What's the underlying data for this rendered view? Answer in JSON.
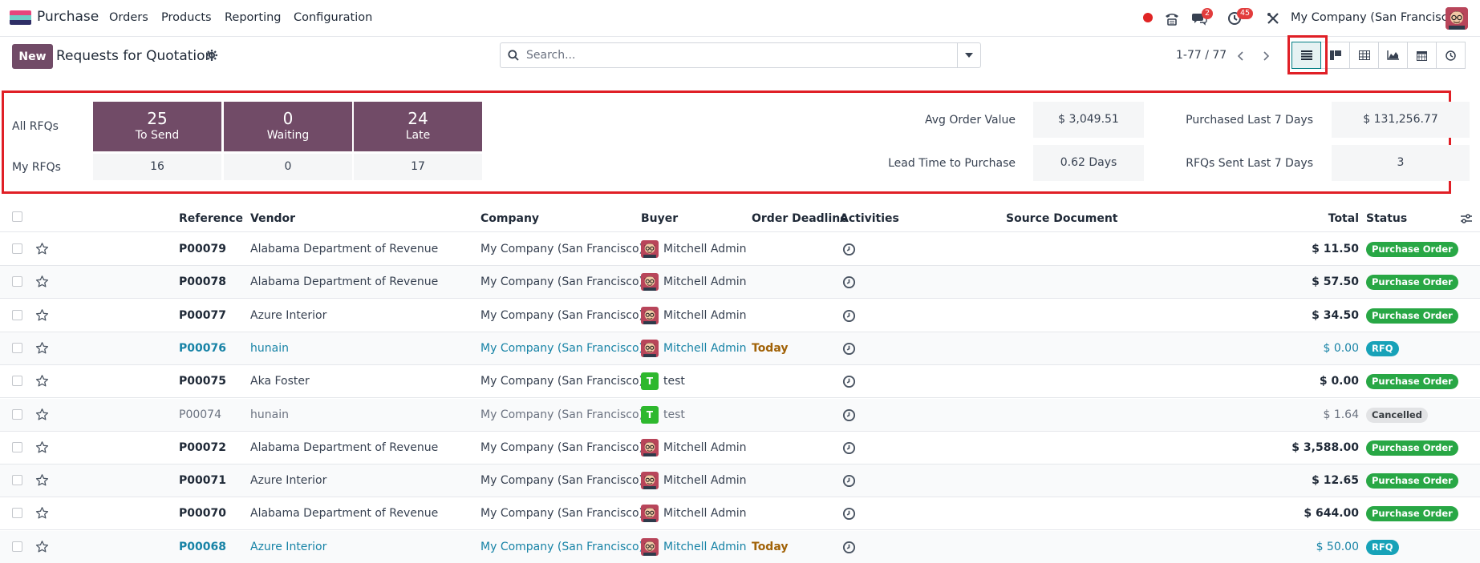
{
  "navbar": {
    "app_name": "Purchase",
    "menu": [
      "Orders",
      "Products",
      "Reporting",
      "Configuration"
    ],
    "messages_badge": "2",
    "activities_badge": "45",
    "company": "My Company (San Francisco)"
  },
  "control_panel": {
    "new_label": "New",
    "title": "Requests for Quotation",
    "search_placeholder": "Search...",
    "pager": "1-77 / 77",
    "views": [
      "list",
      "kanban",
      "pivot",
      "graph",
      "calendar",
      "activity"
    ],
    "active_view": "list"
  },
  "dashboard": {
    "all_rfqs_label": "All RFQs",
    "my_rfqs_label": "My RFQs",
    "tiles": [
      {
        "value": "25",
        "label": "To Send",
        "my": "16"
      },
      {
        "value": "0",
        "label": "Waiting",
        "my": "0"
      },
      {
        "value": "24",
        "label": "Late",
        "my": "17"
      }
    ],
    "kpis": [
      {
        "label": "Avg Order Value",
        "value": "$ 3,049.51"
      },
      {
        "label": "Purchased Last 7 Days",
        "value": "$ 131,256.77"
      },
      {
        "label": "Lead Time to Purchase",
        "value": "0.62 Days"
      },
      {
        "label": "RFQs Sent Last 7 Days",
        "value": "3"
      }
    ]
  },
  "table": {
    "headers": {
      "reference": "Reference",
      "vendor": "Vendor",
      "company": "Company",
      "buyer": "Buyer",
      "deadline": "Order Deadline",
      "activities": "Activities",
      "source": "Source Document",
      "total": "Total",
      "status": "Status"
    },
    "rows": [
      {
        "ref": "P00079",
        "vendor": "Alabama Department of Revenue",
        "company": "My Company (San Francisco)",
        "buyer": "Mitchell Admin",
        "buyer_avatar": "photo",
        "deadline": "",
        "total": "$ 11.50",
        "status": "Purchase Order",
        "kind": "po"
      },
      {
        "ref": "P00078",
        "vendor": "Alabama Department of Revenue",
        "company": "My Company (San Francisco)",
        "buyer": "Mitchell Admin",
        "buyer_avatar": "photo",
        "deadline": "",
        "total": "$ 57.50",
        "status": "Purchase Order",
        "kind": "po"
      },
      {
        "ref": "P00077",
        "vendor": "Azure Interior",
        "company": "My Company (San Francisco)",
        "buyer": "Mitchell Admin",
        "buyer_avatar": "photo",
        "deadline": "",
        "total": "$ 34.50",
        "status": "Purchase Order",
        "kind": "po"
      },
      {
        "ref": "P00076",
        "vendor": "hunain",
        "company": "My Company (San Francisco)",
        "buyer": "Mitchell Admin",
        "buyer_avatar": "photo",
        "deadline": "Today",
        "total": "$ 0.00",
        "status": "RFQ",
        "kind": "rfq"
      },
      {
        "ref": "P00075",
        "vendor": "Aka Foster",
        "company": "My Company (San Francisco)",
        "buyer": "test",
        "buyer_avatar": "T",
        "deadline": "",
        "total": "$ 0.00",
        "status": "Purchase Order",
        "kind": "po"
      },
      {
        "ref": "P00074",
        "vendor": "hunain",
        "company": "My Company (San Francisco)",
        "buyer": "test",
        "buyer_avatar": "T",
        "deadline": "",
        "total": "$ 1.64",
        "status": "Cancelled",
        "kind": "cancel"
      },
      {
        "ref": "P00072",
        "vendor": "Alabama Department of Revenue",
        "company": "My Company (San Francisco)",
        "buyer": "Mitchell Admin",
        "buyer_avatar": "photo",
        "deadline": "",
        "total": "$ 3,588.00",
        "status": "Purchase Order",
        "kind": "po"
      },
      {
        "ref": "P00071",
        "vendor": "Azure Interior",
        "company": "My Company (San Francisco)",
        "buyer": "Mitchell Admin",
        "buyer_avatar": "photo",
        "deadline": "",
        "total": "$ 12.65",
        "status": "Purchase Order",
        "kind": "po"
      },
      {
        "ref": "P00070",
        "vendor": "Alabama Department of Revenue",
        "company": "My Company (San Francisco)",
        "buyer": "Mitchell Admin",
        "buyer_avatar": "photo",
        "deadline": "",
        "total": "$ 644.00",
        "status": "Purchase Order",
        "kind": "po"
      },
      {
        "ref": "P00068",
        "vendor": "Azure Interior",
        "company": "My Company (San Francisco)",
        "buyer": "Mitchell Admin",
        "buyer_avatar": "photo",
        "deadline": "Today",
        "total": "$ 50.00",
        "status": "RFQ",
        "kind": "rfq"
      }
    ]
  },
  "colors": {
    "brand": "#714b67",
    "link": "#1783a6",
    "po": "#28a745",
    "rfq": "#17a2b8",
    "highlight": "#e01f26"
  }
}
